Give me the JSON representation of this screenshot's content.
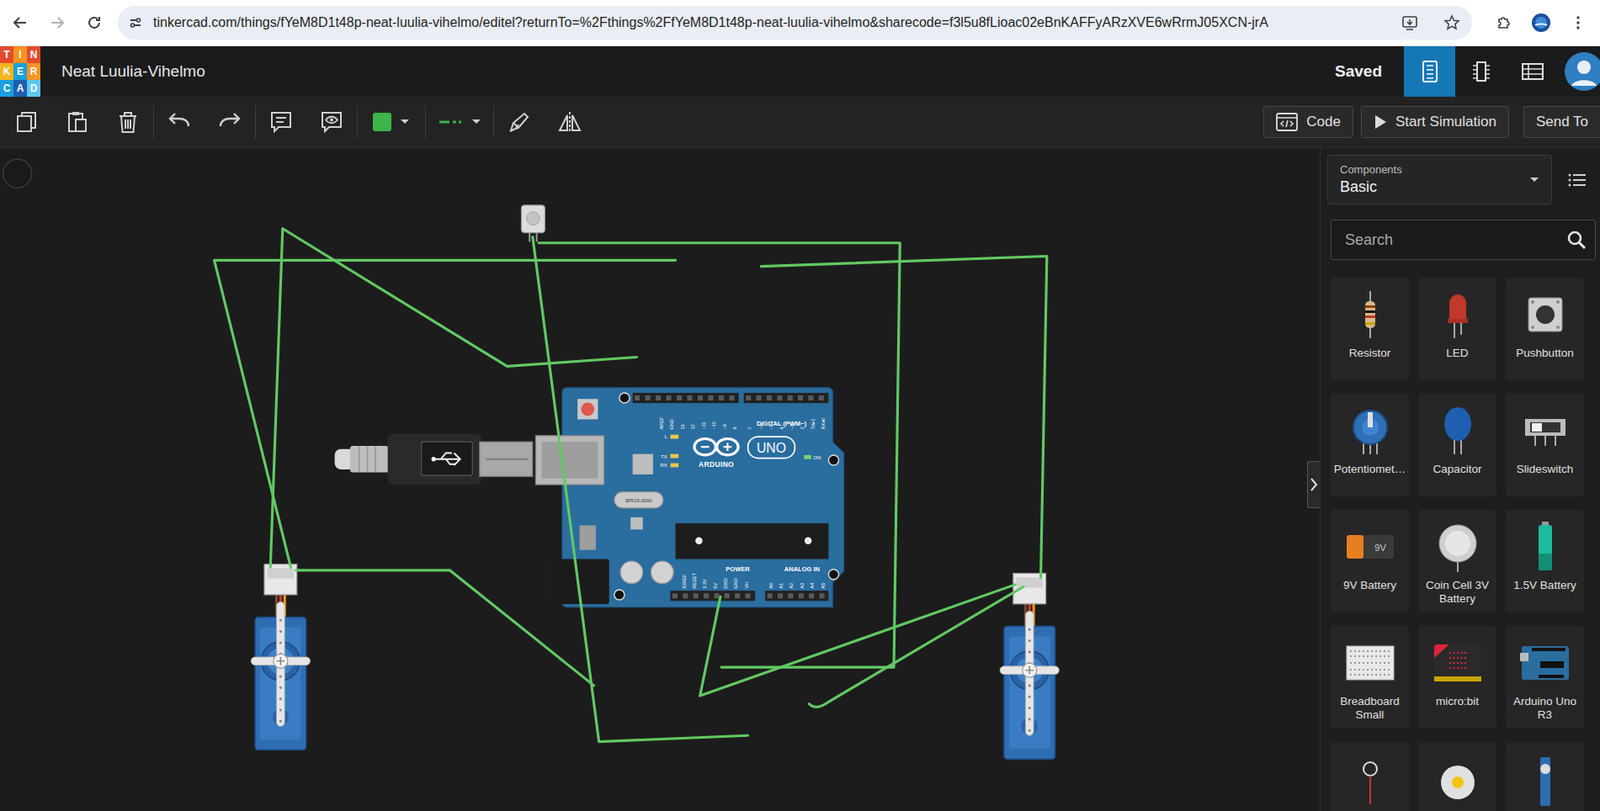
{
  "browser": {
    "url": "tinkercad.com/things/fYeM8D1t48p-neat-luulia-vihelmo/editel?returnTo=%2Fthings%2FfYeM8D1t48p-neat-luulia-vihelmo&sharecode=f3l5u8fLioac02eBnKAFFyARzXVE6wRrmJ05XCN-jrA"
  },
  "header": {
    "logo": [
      {
        "letter": "T",
        "color": "#e44b2d"
      },
      {
        "letter": "I",
        "color": "#f7931e"
      },
      {
        "letter": "N",
        "color": "#e44b2d"
      },
      {
        "letter": "K",
        "color": "#f7b51e"
      },
      {
        "letter": "E",
        "color": "#1aa0dc"
      },
      {
        "letter": "R",
        "color": "#f7931e"
      },
      {
        "letter": "C",
        "color": "#1aa0dc"
      },
      {
        "letter": "A",
        "color": "#1d5fae"
      },
      {
        "letter": "D",
        "color": "#5cc8f0"
      }
    ],
    "title": "Neat Luulia-Vihelmo",
    "status": "Saved",
    "views": [
      {
        "kind": "circuit",
        "selected": true
      },
      {
        "kind": "schematic",
        "selected": false
      },
      {
        "kind": "list",
        "selected": false
      }
    ]
  },
  "toolbar": {
    "wire_color": "#3db54a",
    "buttons": [
      {
        "kind": "code",
        "label": "Code"
      },
      {
        "kind": "simulate",
        "label": "Start Simulation"
      },
      {
        "kind": "send",
        "label": "Send To"
      }
    ]
  },
  "canvas": {
    "wire_color": "#62c962",
    "parts": [
      {
        "kind": "usb-cable"
      },
      {
        "kind": "arduino"
      },
      {
        "kind": "ir-sensor"
      },
      {
        "kind": "servo"
      },
      {
        "kind": "servo"
      }
    ],
    "board": {
      "brand": "ARDUINO",
      "model": "UNO",
      "digital_label": "DIGITAL (PWM~)",
      "power_label": "POWER",
      "analog_label": "ANALOG IN",
      "on_label": "ON",
      "led_labels": [
        "L",
        "TX",
        "RX"
      ],
      "crystal": "SPK16.000G",
      "digital_pins": [
        "AREF",
        "GND",
        "13",
        "12",
        "~11",
        "~10",
        "~9",
        "8",
        "7",
        "~6",
        "~5",
        "4",
        "~3",
        "2",
        "TX▸1",
        "RX◂0"
      ],
      "power_pins": [
        "IOREF",
        "RESET",
        "3.3V",
        "5V",
        "GND",
        "GND",
        "Vin"
      ],
      "analog_pins": [
        "A0",
        "A1",
        "A2",
        "A3",
        "A4",
        "A5"
      ]
    }
  },
  "panel": {
    "label": "Components",
    "category": "Basic",
    "search_placeholder": "Search",
    "items": [
      {
        "kind": "resistor",
        "label": "Resistor"
      },
      {
        "kind": "led",
        "label": "LED"
      },
      {
        "kind": "pushbutton",
        "label": "Pushbutton"
      },
      {
        "kind": "potentiometer",
        "label": "Potentiomet…"
      },
      {
        "kind": "capacitor",
        "label": "Capacitor"
      },
      {
        "kind": "slideswitch",
        "label": "Slideswitch"
      },
      {
        "kind": "battery9v",
        "label": "9V Battery",
        "icon_text": "9V"
      },
      {
        "kind": "coincell",
        "label": "Coin Cell 3V Battery"
      },
      {
        "kind": "battery15v",
        "label": "1.5V Battery"
      },
      {
        "kind": "breadboard",
        "label": "Breadboard Small"
      },
      {
        "kind": "microbit",
        "label": "micro:bit"
      },
      {
        "kind": "arduino",
        "label": "Arduino Uno R3"
      },
      {
        "kind": "probe"
      },
      {
        "kind": "motor"
      },
      {
        "kind": "servo"
      }
    ]
  }
}
